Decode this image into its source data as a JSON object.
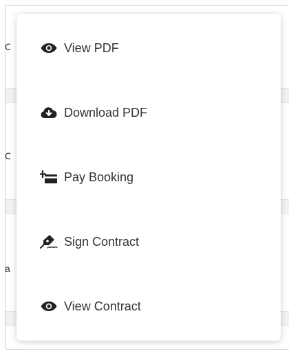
{
  "menu": {
    "items": [
      {
        "label": "View PDF",
        "icon": "eye-icon"
      },
      {
        "label": "Download PDF",
        "icon": "cloud-download-icon"
      },
      {
        "label": "Pay Booking",
        "icon": "pay-card-icon"
      },
      {
        "label": "Sign Contract",
        "icon": "pen-signature-icon"
      },
      {
        "label": "View Contract",
        "icon": "eye-icon"
      }
    ]
  },
  "background": {
    "clipped_chars": [
      "C",
      "C",
      "a"
    ]
  },
  "colors": {
    "text": "#333333",
    "icon": "#222222",
    "menu_bg": "#ffffff",
    "row_bg": "#f2f2f2"
  }
}
